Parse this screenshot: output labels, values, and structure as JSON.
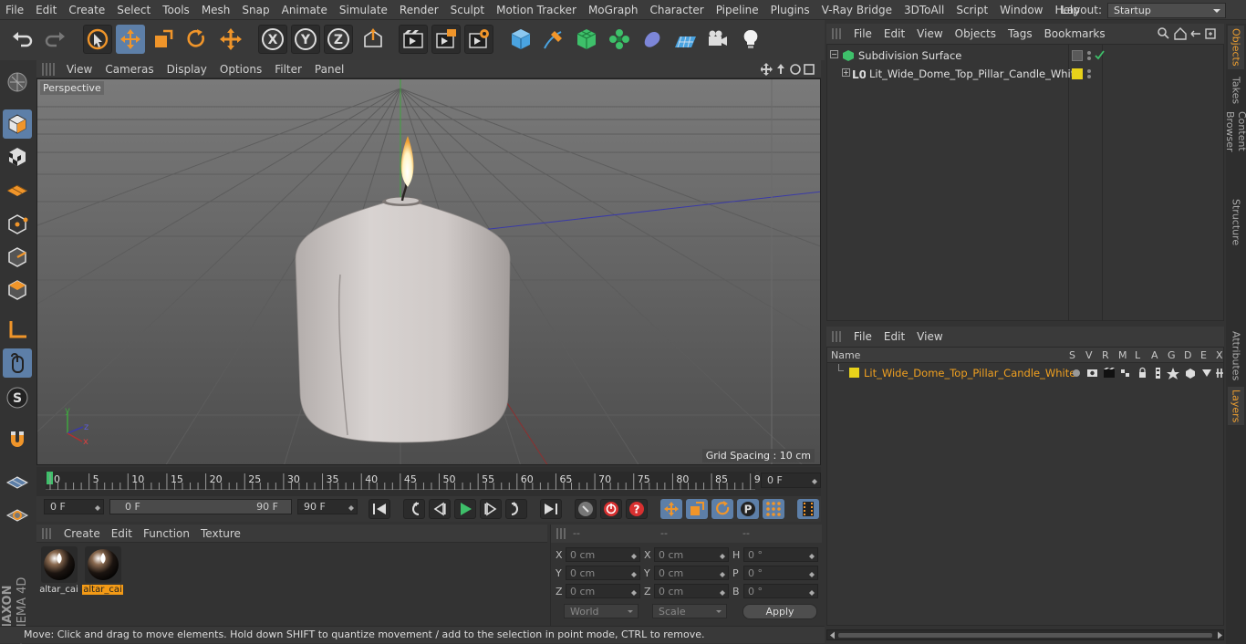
{
  "menubar": {
    "items": [
      "File",
      "Edit",
      "Create",
      "Select",
      "Tools",
      "Mesh",
      "Snap",
      "Animate",
      "Simulate",
      "Render",
      "Sculpt",
      "Motion Tracker",
      "MoGraph",
      "Character",
      "Pipeline",
      "Plugins",
      "V-Ray Bridge",
      "3DToAll",
      "Script",
      "Window",
      "Help"
    ],
    "layout_label": "Layout:",
    "layout_value": "Startup"
  },
  "toolbar": {
    "icons": [
      "undo-icon",
      "redo-icon",
      "live-selection-icon",
      "move-icon",
      "scale-icon",
      "rotate-icon",
      "last-tool-icon",
      "x-axis-icon",
      "y-axis-icon",
      "z-axis-icon",
      "coordinate-system-icon",
      "render-view-icon",
      "render-to-picture-viewer-icon",
      "edit-render-settings-icon",
      "cube-icon",
      "pen-icon",
      "subdivision-icon",
      "cloner-icon",
      "deformer-icon",
      "floor-icon",
      "camera-icon",
      "light-icon"
    ],
    "axis_x": "X",
    "axis_y": "Y",
    "axis_z": "Z"
  },
  "viewport": {
    "menu": [
      "View",
      "Cameras",
      "Display",
      "Options",
      "Filter",
      "Panel"
    ],
    "label": "Perspective",
    "grid_spacing": "Grid Spacing : 10 cm"
  },
  "timeline": {
    "ticks": [
      "0",
      "5",
      "10",
      "15",
      "20",
      "25",
      "30",
      "35",
      "40",
      "45",
      "50",
      "55",
      "60",
      "65",
      "70",
      "75",
      "80",
      "85",
      "90"
    ],
    "current_frame": "0 F"
  },
  "transport": {
    "start_field": "0 F",
    "range_start": "0 F",
    "range_end": "90 F",
    "end_field": "90 F"
  },
  "materials": {
    "menu": [
      "Create",
      "Edit",
      "Function",
      "Texture"
    ],
    "items": [
      {
        "name": "altar_cai",
        "selected": false
      },
      {
        "name": "altar_cai",
        "selected": true
      }
    ]
  },
  "coordinates": {
    "headers": [
      "--",
      "--",
      "--"
    ],
    "rows": [
      {
        "l1": "X",
        "v1": "0 cm",
        "l2": "X",
        "v2": "0 cm",
        "l3": "H",
        "v3": "0 °"
      },
      {
        "l1": "Y",
        "v1": "0 cm",
        "l2": "Y",
        "v2": "0 cm",
        "l3": "P",
        "v3": "0 °"
      },
      {
        "l1": "Z",
        "v1": "0 cm",
        "l2": "Z",
        "v2": "0 cm",
        "l3": "B",
        "v3": "0 °"
      }
    ],
    "world": "World",
    "scale": "Scale",
    "apply": "Apply"
  },
  "status": "Move: Click and drag to move elements. Hold down SHIFT to quantize movement / add to the selection in point mode, CTRL to remove.",
  "objects_panel": {
    "menu": [
      "File",
      "Edit",
      "View",
      "Objects",
      "Tags",
      "Bookmarks"
    ],
    "items": [
      {
        "name": "Subdivision Surface"
      },
      {
        "name": "Lit_Wide_Dome_Top_Pillar_Candle_White"
      }
    ]
  },
  "layers_panel": {
    "menu": [
      "File",
      "Edit",
      "View"
    ],
    "columns": [
      "Name",
      "S",
      "V",
      "R",
      "M",
      "L",
      "A",
      "G",
      "D",
      "E",
      "X"
    ],
    "items": [
      {
        "name": "Lit_Wide_Dome_Top_Pillar_Candle_White",
        "color": "#e8d21a"
      }
    ]
  },
  "right_tabs": [
    "Objects",
    "Takes",
    "Content Browser",
    "Structure",
    "Attributes",
    "Layers"
  ],
  "colors": {
    "accent": "#5d7fa8",
    "highlight": "#f39a16",
    "layer": "#e8d21a"
  }
}
